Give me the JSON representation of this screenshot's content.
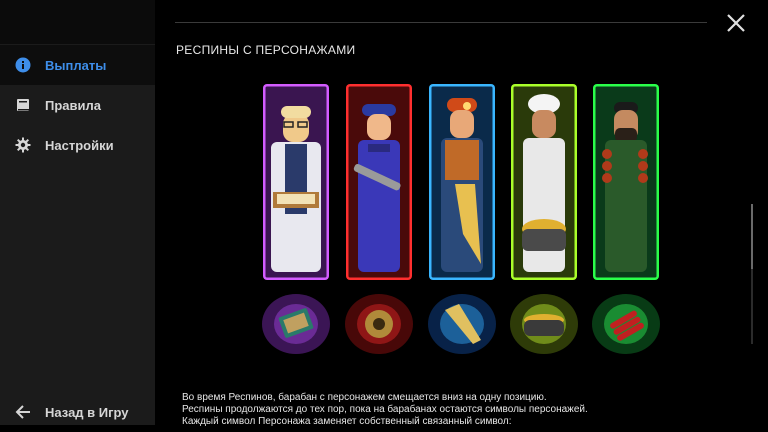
{
  "sidebar": {
    "items": [
      {
        "label": "Выплаты",
        "icon": "info-icon",
        "active": true
      },
      {
        "label": "Правила",
        "icon": "book-icon",
        "active": false
      },
      {
        "label": "Настройки",
        "icon": "gear-icon",
        "active": false
      }
    ],
    "back_label": "Назад в Игру",
    "active_color": "#3e8eea"
  },
  "main": {
    "section_title": "РЕСПИНЫ С ПЕРСОНАЖАМИ",
    "characters": [
      {
        "name": "scientist",
        "frame_color": "#c548ff"
      },
      {
        "name": "mechanic",
        "frame_color": "#ff2a2a"
      },
      {
        "name": "miner",
        "frame_color": "#3ab6ff"
      },
      {
        "name": "chef",
        "frame_color": "#a8ff2a"
      },
      {
        "name": "bbq-man",
        "frame_color": "#2aff4a"
      }
    ],
    "symbols": [
      "book-symbol",
      "gear-symbol",
      "drill-symbol",
      "pot-symbol",
      "dynamite-symbol"
    ],
    "description": [
      "Во время Респинов, барабан с персонажем смещается вниз на одну позицию.",
      "Респины продолжаются до тех пор, пока на барабанах остаются символы персонажей.",
      "Каждый символ Персонажа заменяет собственный связанный символ:"
    ]
  }
}
